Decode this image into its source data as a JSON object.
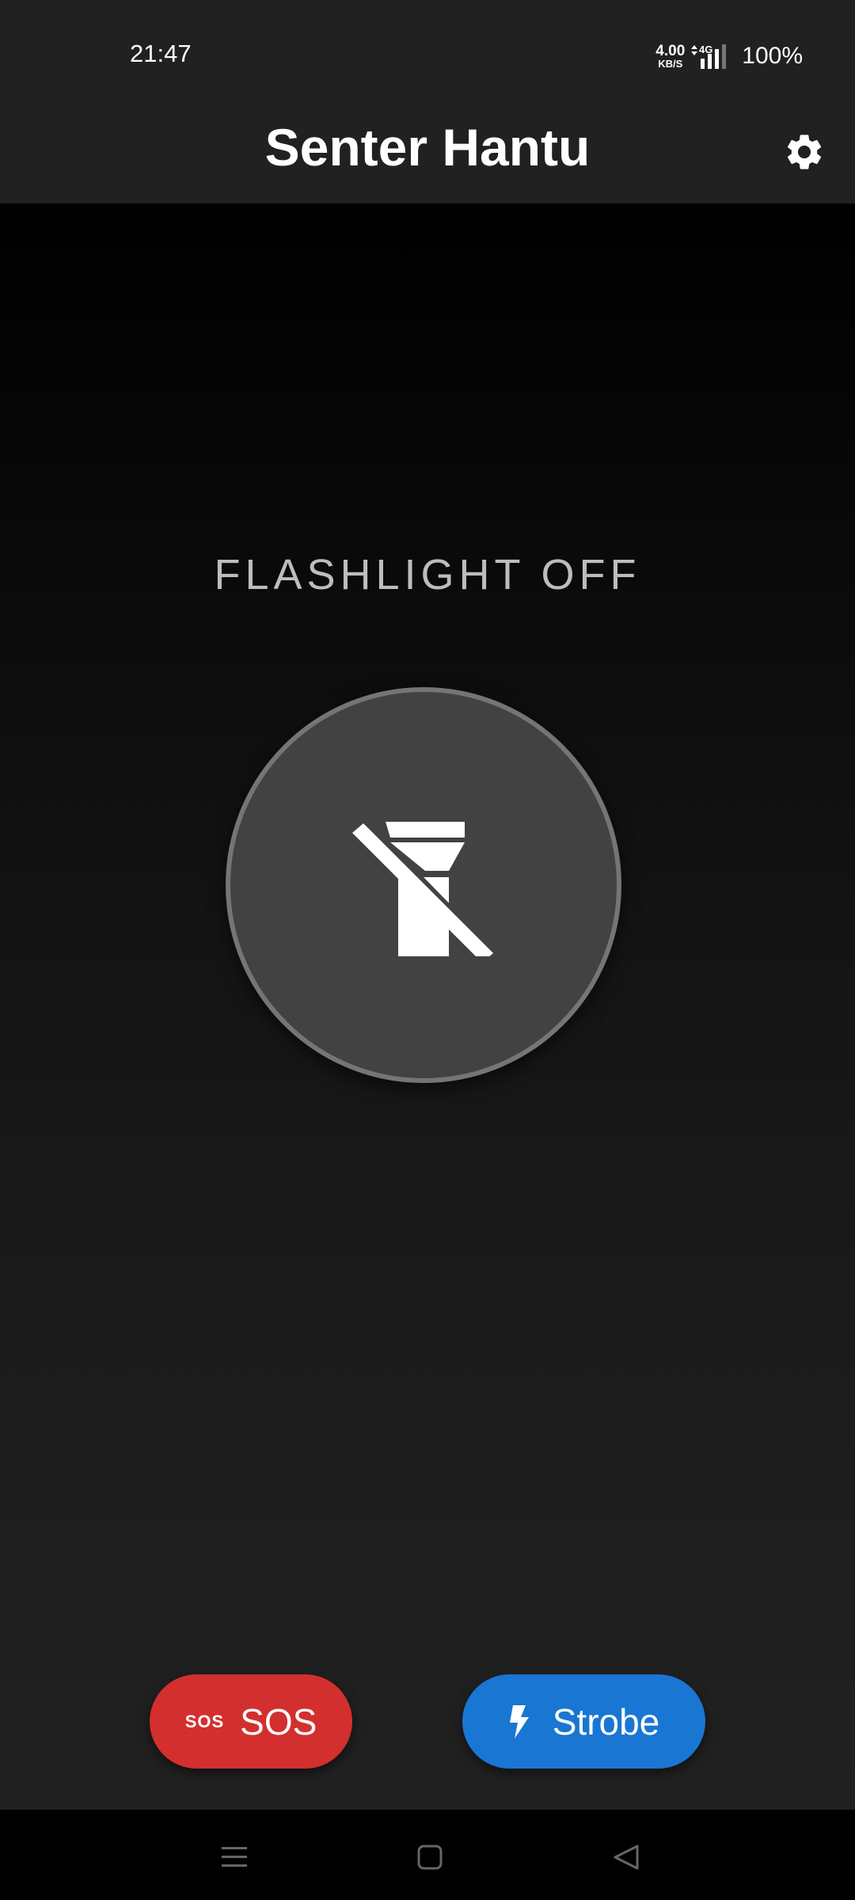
{
  "status_bar": {
    "time": "21:47",
    "net_speed_value": "4.00",
    "net_speed_unit": "KB/S",
    "network_type": "4G",
    "battery": "100%"
  },
  "app_bar": {
    "title": "Senter Hantu",
    "settings_icon": "gear-icon"
  },
  "main": {
    "flashlight_status": "FLASHLIGHT OFF",
    "power_icon": "flashlight-off-icon"
  },
  "actions": {
    "sos_icon_text": "SOS",
    "sos_label": "SOS",
    "strobe_label": "Strobe",
    "sos_color": "#d32f2f",
    "strobe_color": "#1976d2"
  },
  "nav_bar": {
    "menu_icon": "menu-icon",
    "home_icon": "home-icon",
    "back_icon": "back-icon"
  }
}
